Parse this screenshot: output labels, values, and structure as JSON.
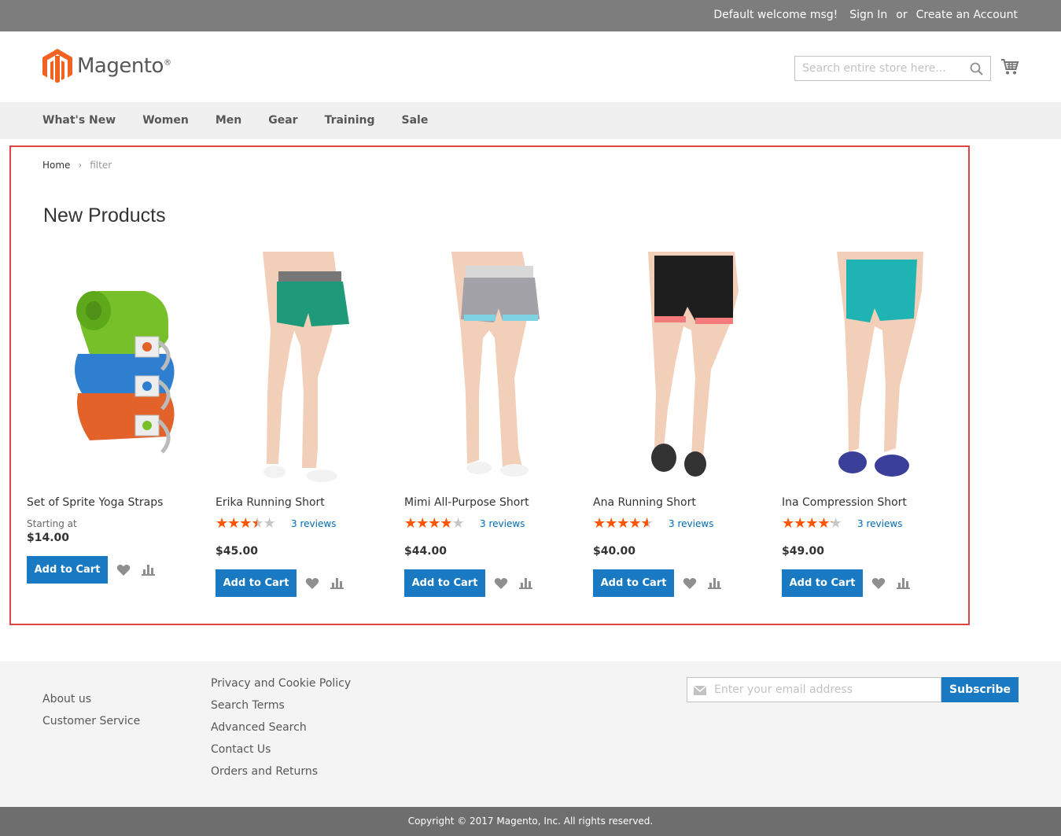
{
  "topbar": {
    "welcome": "Default welcome msg!",
    "sign_in": "Sign In",
    "or": "or",
    "create_account": "Create an Account"
  },
  "header": {
    "logo_text": "Magento",
    "search": {
      "placeholder": "Search entire store here..."
    }
  },
  "nav": {
    "items": [
      "What's New",
      "Women",
      "Men",
      "Gear",
      "Training",
      "Sale"
    ]
  },
  "breadcrumb": {
    "home": "Home",
    "separator": "›",
    "current": "filter"
  },
  "page": {
    "title": "New Products"
  },
  "products": [
    {
      "name": "Set of Sprite Yoga Straps",
      "starting_label": "Starting at",
      "price": "$14.00",
      "add_to_cart": "Add to Cart"
    },
    {
      "name": "Erika Running Short",
      "rating_fraction": 0.6,
      "reviews": "3 reviews",
      "price": "$45.00",
      "add_to_cart": "Add to Cart"
    },
    {
      "name": "Mimi All-Purpose Short",
      "rating_fraction": 0.67,
      "reviews": "3 reviews",
      "price": "$44.00",
      "add_to_cart": "Add to Cart"
    },
    {
      "name": "Ana Running Short",
      "rating_fraction": 0.8,
      "reviews": "3 reviews",
      "price": "$40.00",
      "add_to_cart": "Add to Cart"
    },
    {
      "name": "Ina Compression Short",
      "rating_fraction": 0.73,
      "reviews": "3 reviews",
      "price": "$49.00",
      "add_to_cart": "Add to Cart"
    }
  ],
  "footer": {
    "col1": [
      "About us",
      "Customer Service"
    ],
    "col2": [
      "Privacy and Cookie Policy",
      "Search Terms",
      "Advanced Search",
      "Contact Us",
      "Orders and Returns"
    ],
    "newsletter": {
      "placeholder": "Enter your email address",
      "button": "Subscribe"
    },
    "copyright": "Copyright © 2017 Magento, Inc. All rights reserved."
  },
  "colors": {
    "accent": "#1979c3",
    "star": "#ff5501",
    "brand_orange": "#f26322",
    "highlight": "#e04343"
  }
}
